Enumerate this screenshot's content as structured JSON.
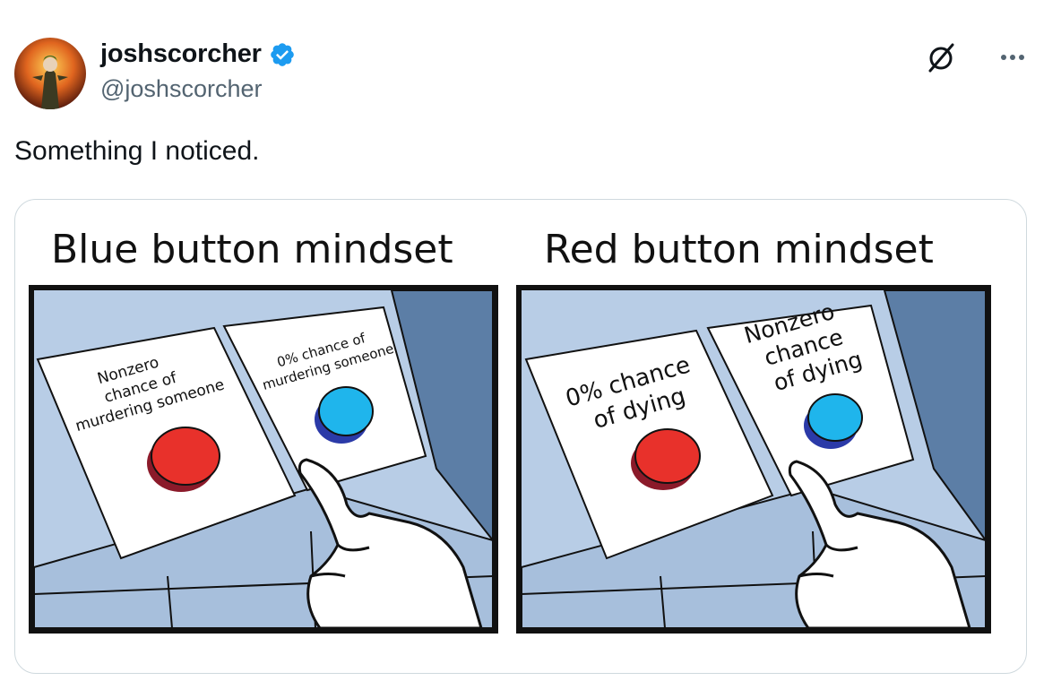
{
  "author": {
    "display_name": "joshscorcher",
    "handle": "@joshscorcher",
    "verified": true
  },
  "tweet": {
    "text": "Something I noticed."
  },
  "actions": {
    "grok_icon": "grok-icon",
    "more_icon": "more-icon"
  },
  "meme": {
    "left_panel": {
      "title": "Blue button mindset",
      "left_sign": [
        "Nonzero",
        "chance of",
        "murdering someone"
      ],
      "right_sign": [
        "0% chance of",
        "murdering someone"
      ]
    },
    "right_panel": {
      "title": "Red button mindset",
      "left_sign": [
        "0% chance",
        "of dying"
      ],
      "right_sign": [
        "Nonzero",
        "chance",
        "of dying"
      ]
    }
  },
  "colors": {
    "verified_blue": "#1d9bf0",
    "desk_blue": "#b8cde6",
    "wall_blue": "#5c7ea6",
    "red_button": "#e8312b",
    "blue_button": "#1fb5ec"
  }
}
